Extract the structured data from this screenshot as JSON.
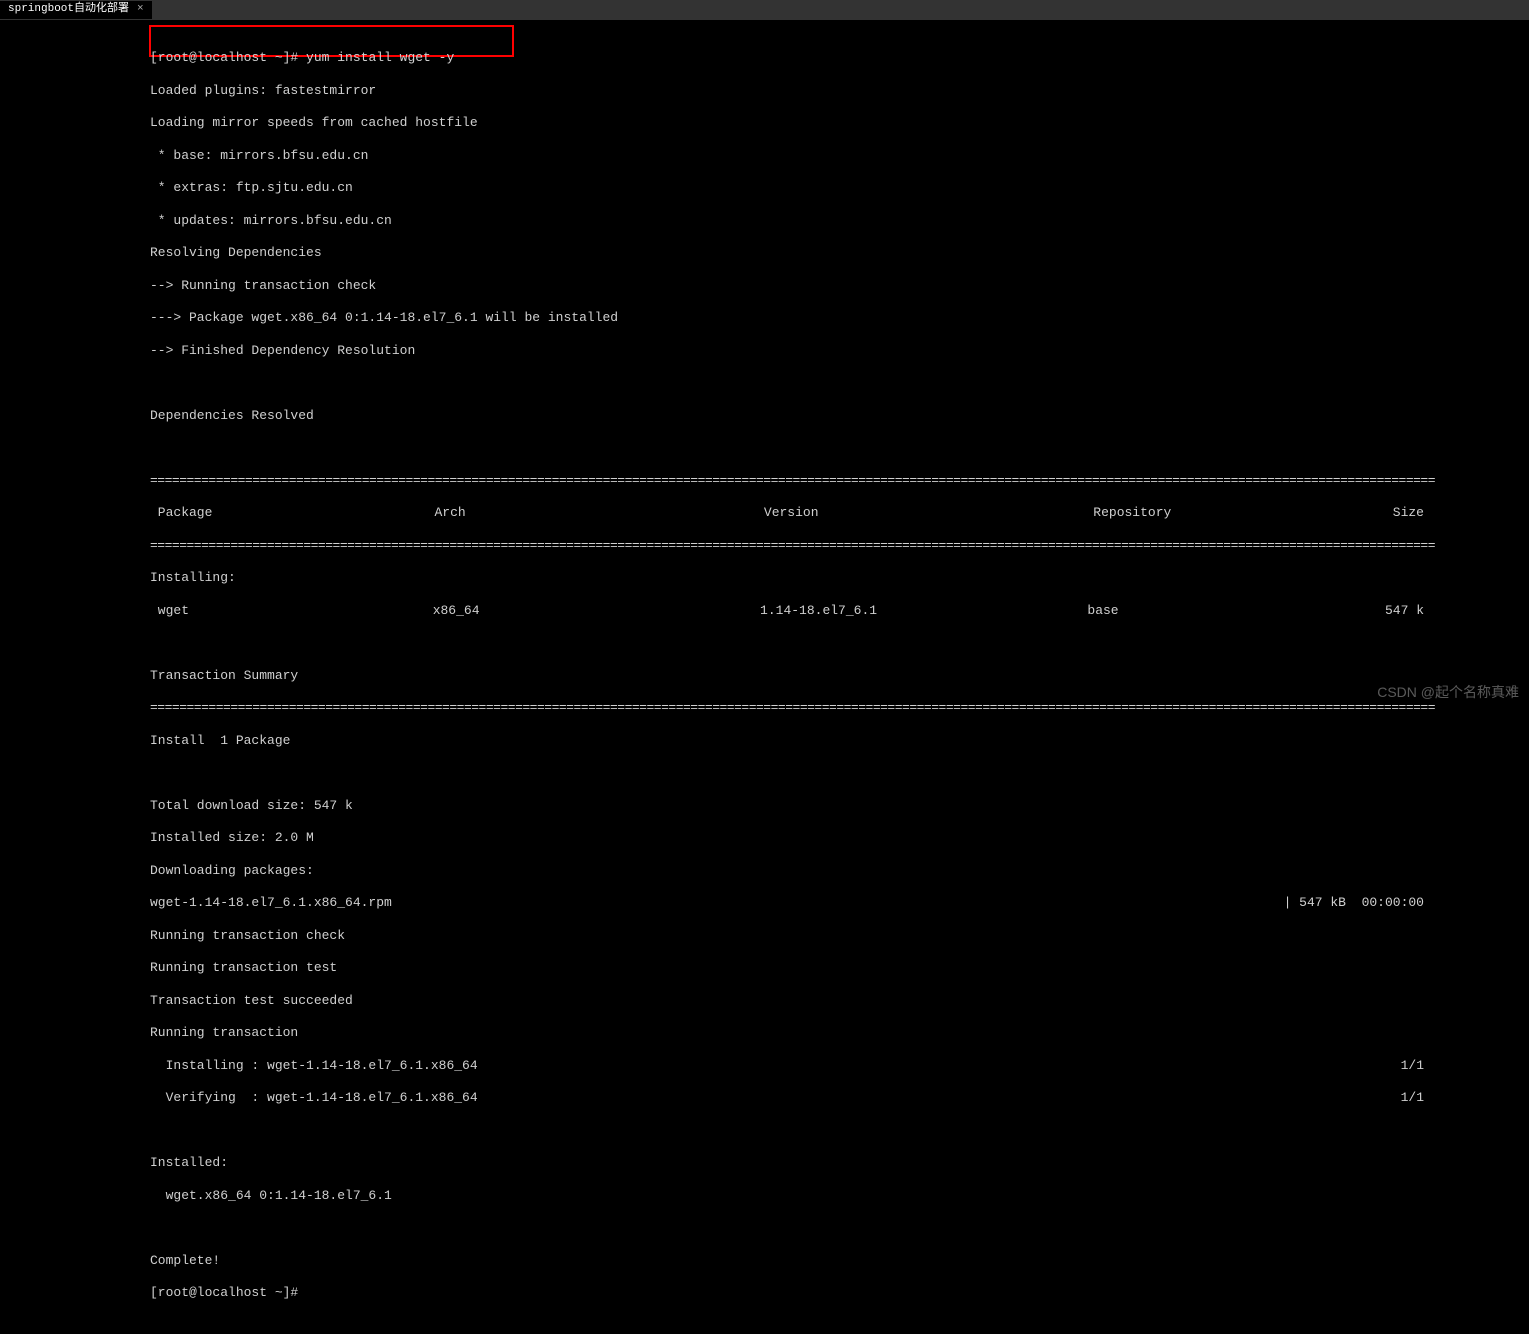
{
  "tab": {
    "title": "springboot自动化部署",
    "close": "×"
  },
  "prompt": "[root@localhost ~]# ",
  "command": "yum install wget -y",
  "lines": {
    "loaded_plugins": "Loaded plugins: fastestmirror",
    "loading_mirror": "Loading mirror speeds from cached hostfile",
    "base_mirror": " * base: mirrors.bfsu.edu.cn",
    "extras_mirror": " * extras: ftp.sjtu.edu.cn",
    "updates_mirror": " * updates: mirrors.bfsu.edu.cn",
    "resolving": "Resolving Dependencies",
    "running_check": "--> Running transaction check",
    "package_info": "---> Package wget.x86_64 0:1.14-18.el7_6.1 will be installed",
    "finished_dep": "--> Finished Dependency Resolution",
    "deps_resolved": "Dependencies Resolved",
    "installing_label": "Installing:",
    "transaction_summary": "Transaction Summary",
    "install_count": "Install  1 Package",
    "total_download": "Total download size: 547 k",
    "installed_size": "Installed size: 2.0 M",
    "downloading": "Downloading packages:",
    "rpm_file": "wget-1.14-18.el7_6.1.x86_64.rpm",
    "download_speed": "| 547 kB  00:00:00",
    "run_trans_check": "Running transaction check",
    "run_trans_test": "Running transaction test",
    "trans_succeeded": "Transaction test succeeded",
    "run_trans": "Running transaction",
    "installing_step": "  Installing : wget-1.14-18.el7_6.1.x86_64",
    "verifying_step": "  Verifying  : wget-1.14-18.el7_6.1.x86_64",
    "ratio": "1/1",
    "installed_label": "Installed:",
    "installed_pkg": "  wget.x86_64 0:1.14-18.el7_6.1",
    "complete": "Complete!",
    "final_prompt": "[root@localhost ~]# "
  },
  "table": {
    "headers": {
      "package": " Package",
      "arch": "Arch",
      "version": "Version",
      "repository": "Repository",
      "size": "Size"
    },
    "row": {
      "package": " wget",
      "arch": "x86_64",
      "version": "1.14-18.el7_6.1",
      "repository": "base",
      "size": "547 k"
    }
  },
  "separator": "================================================================================================================================================================================",
  "watermark": "CSDN @起个名称真难"
}
